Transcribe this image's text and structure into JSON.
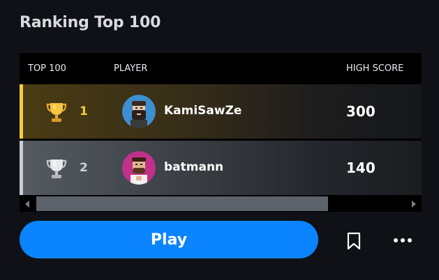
{
  "header": {
    "title": "Ranking Top 100"
  },
  "table": {
    "columns": {
      "rank": "TOP 100",
      "player": "PLAYER",
      "score": "HIGH SCORE"
    },
    "rows": [
      {
        "rank": "1",
        "player": "KamiSawZe",
        "score": "300",
        "trophy_icon": "gold-trophy-icon",
        "accent": "#f2cf3a"
      },
      {
        "rank": "2",
        "player": "batmann",
        "score": "140",
        "trophy_icon": "silver-trophy-icon",
        "accent": "#c9ccd1"
      }
    ]
  },
  "actions": {
    "play_label": "Play",
    "bookmark_icon": "bookmark-icon",
    "more_icon": "more-dots-icon"
  },
  "colors": {
    "background": "#0f1116",
    "primary": "#0a84ff",
    "gold": "#f2cf3a",
    "silver": "#c9ccd1"
  }
}
